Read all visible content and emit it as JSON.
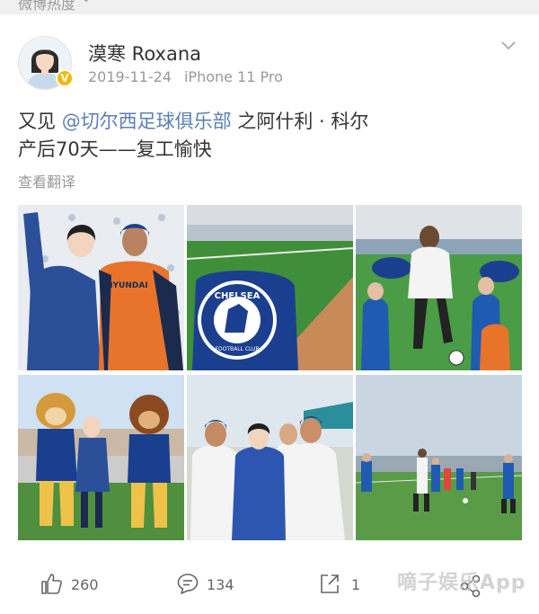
{
  "top_hint": {
    "text": "微博热度"
  },
  "post": {
    "username": "漠寒 Roxana",
    "date": "2019-11-24",
    "device": "iPhone 11 Pro",
    "text_line1_prefix": "又见",
    "mention": "@切尔西足球俱乐部",
    "text_line1_suffix": "之阿什利 · 科尔",
    "text_line2": "产后70天——复工愉快",
    "translate_label": "查看翻译"
  },
  "photos": {
    "p2_badge_top": "CHELSEA",
    "p2_badge_bottom": "FOOTBALL CLUB",
    "p1_shirt_text": "HYUNDAI"
  },
  "actions": {
    "likes": "260",
    "comments": "134",
    "shares": "1"
  },
  "watermark": {
    "text": "嘀子娱乐App"
  },
  "colors": {
    "mention": "#5b7fb5",
    "verified_badge": "#f7b500",
    "chelsea_blue": "#1b3f8f"
  },
  "icons": [
    "chevron-down-icon",
    "verified-icon",
    "like-icon",
    "comment-icon",
    "share-icon",
    "more-share-icon"
  ]
}
